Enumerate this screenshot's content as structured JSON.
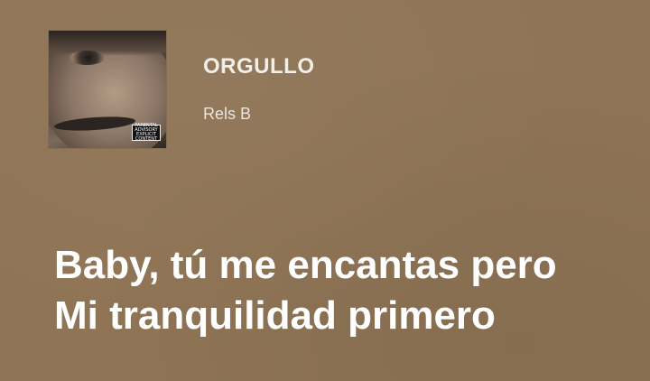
{
  "track": {
    "title": "ORGULLO",
    "artist": "Rels B",
    "explicit_badge": "PARENTAL ADVISORY EXPLICIT CONTENT"
  },
  "lyrics": [
    "Baby, tú me encantas pero",
    "Mi tranquilidad primero"
  ],
  "colors": {
    "background": "#8f7455",
    "title_text": "#f2efe9",
    "lyrics_text": "#ffffff"
  },
  "icons": {
    "album_cover": "album-cover-image"
  }
}
